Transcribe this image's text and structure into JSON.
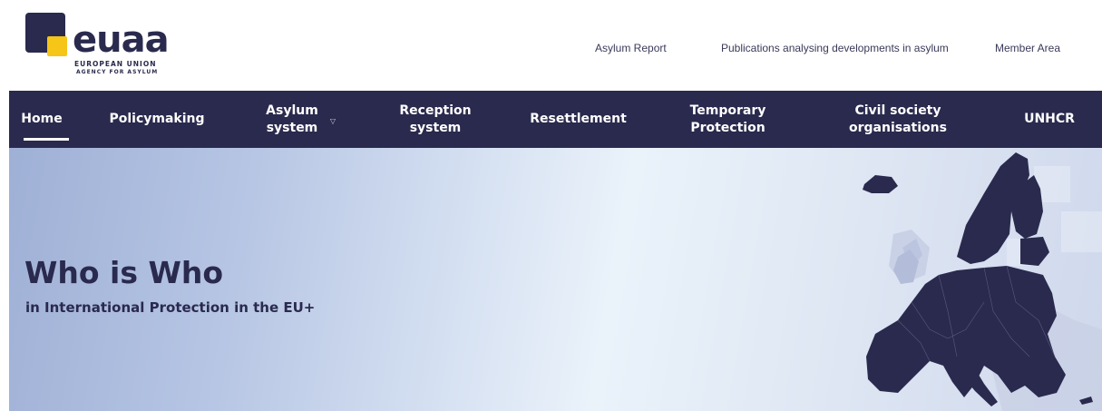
{
  "logo": {
    "word": "euaa",
    "line1": "EUROPEAN UNION",
    "line2": "AGENCY FOR ASYLUM"
  },
  "toplinks": {
    "asylum_report": "Asylum Report",
    "publications": "Publications analysing developments in asylum",
    "member_area": "Member Area"
  },
  "nav": {
    "home": "Home",
    "policymaking": "Policymaking",
    "asylum_1": "Asylum",
    "asylum_2": "system",
    "reception_1": "Reception",
    "reception_2": "system",
    "resettlement": "Resettlement",
    "temporary_1": "Temporary",
    "temporary_2": "Protection",
    "civil_1": "Civil society",
    "civil_2": "organisations",
    "unhcr": "UNHCR"
  },
  "hero": {
    "title": "Who is Who",
    "subtitle": "in International Protection in the EU+"
  },
  "colors": {
    "brand_dark": "#2a2a4e",
    "brand_yellow": "#f5c518"
  },
  "icons": [
    "chevron-down-icon",
    "europe-map"
  ]
}
